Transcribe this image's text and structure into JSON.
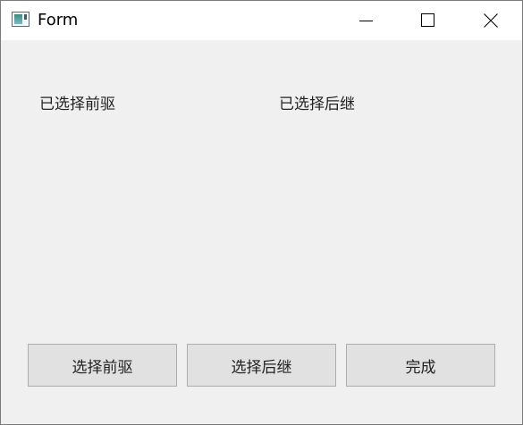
{
  "window": {
    "title": "Form",
    "controls": {
      "minimize_icon": "minimize-icon",
      "maximize_icon": "maximize-icon",
      "close_icon": "close-icon"
    }
  },
  "labels": {
    "selected_predecessor": "已选择前驱",
    "selected_successor": "已选择后继"
  },
  "buttons": {
    "select_predecessor": "选择前驱",
    "select_successor": "选择后继",
    "done": "完成"
  },
  "colors": {
    "window_background": "#f0f0f0",
    "titlebar_background": "#ffffff",
    "button_face": "#e1e1e1",
    "button_border": "#adadad"
  }
}
